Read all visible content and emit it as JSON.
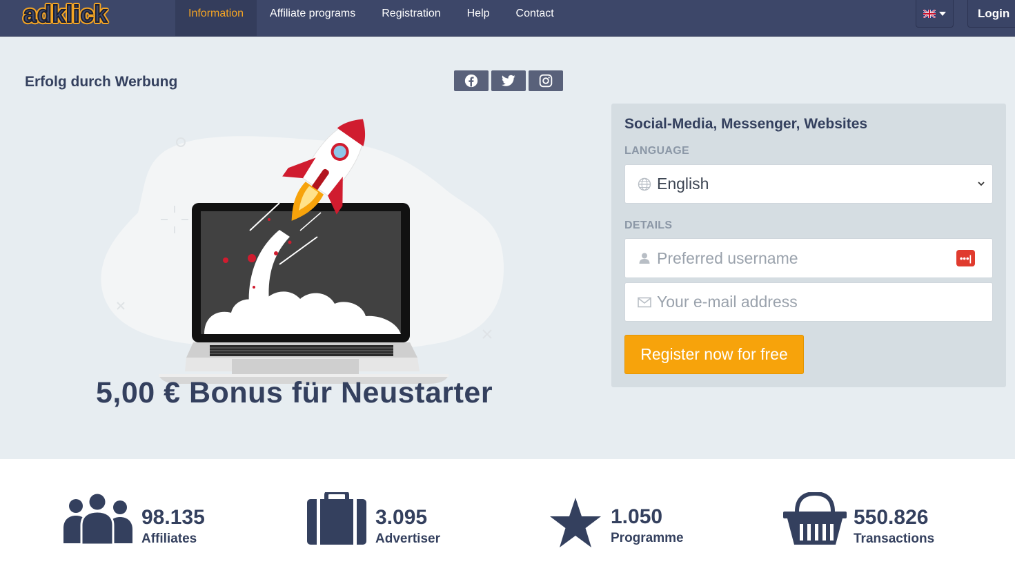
{
  "brand": {
    "logo_text": "adklick"
  },
  "nav": {
    "items": [
      {
        "label": "Information",
        "active": true
      },
      {
        "label": "Affiliate programs",
        "active": false
      },
      {
        "label": "Registration",
        "active": false
      },
      {
        "label": "Help",
        "active": false
      },
      {
        "label": "Contact",
        "active": false
      }
    ],
    "language_flag_icon": "uk-flag-icon",
    "login_label": "Login"
  },
  "hero": {
    "tagline": "Erfolg durch Werbung",
    "social_icons": [
      "facebook-icon",
      "twitter-icon",
      "instagram-icon"
    ],
    "bonus_text": "5,00 € Bonus für Neustarter"
  },
  "register": {
    "title": "Social-Media, Messenger, Websites",
    "language_label": "LANGUAGE",
    "language_value": "English",
    "details_label": "DETAILS",
    "username_placeholder": "Preferred username",
    "email_placeholder": "Your e-mail address",
    "submit_label": "Register now for free"
  },
  "stats": [
    {
      "icon": "users-icon",
      "value": "98.135",
      "label": "Affiliates"
    },
    {
      "icon": "briefcase-icon",
      "value": "3.095",
      "label": "Advertiser"
    },
    {
      "icon": "star-icon",
      "value": "1.050",
      "label": "Programme"
    },
    {
      "icon": "basket-icon",
      "value": "550.826",
      "label": "Transactions"
    }
  ],
  "colors": {
    "nav_bg": "#3d4769",
    "accent": "#f5a524",
    "hero_bg": "#e7edf1",
    "panel_bg": "#d5dde2",
    "button_bg": "#f7a30b",
    "text_dark": "#34405e",
    "password_badge": "#e03b2e"
  }
}
